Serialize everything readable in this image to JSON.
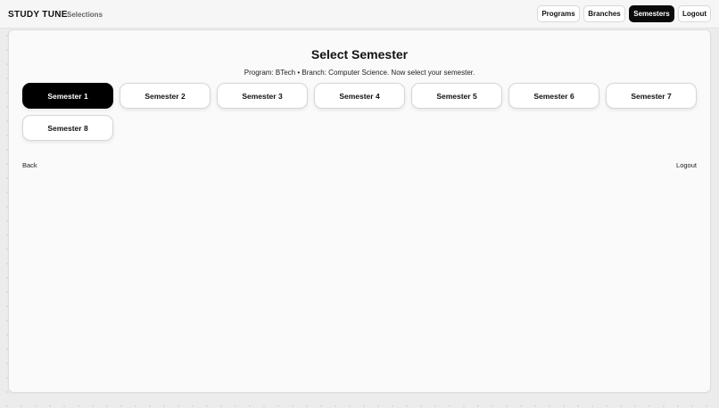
{
  "header": {
    "brand": "STUDY TUNE",
    "section": "Selections",
    "nav": [
      {
        "label": "Programs"
      },
      {
        "label": "Branches"
      },
      {
        "label": "Semesters",
        "active": true
      },
      {
        "label": "Logout"
      }
    ]
  },
  "main": {
    "title": "Select Semester",
    "subtitle": "Program: BTech • Branch: Computer Science. Now select your semester.",
    "semesters": [
      {
        "label": "Semester 1",
        "selected": true
      },
      {
        "label": "Semester 2"
      },
      {
        "label": "Semester 3"
      },
      {
        "label": "Semester 4"
      },
      {
        "label": "Semester 5"
      },
      {
        "label": "Semester 6"
      },
      {
        "label": "Semester 7"
      },
      {
        "label": "Semester 8"
      }
    ],
    "back_label": "Back",
    "logout_label": "Logout"
  },
  "colors": {
    "accent": "#000000",
    "card_bg": "#fafafa",
    "page_bg": "#ececec"
  }
}
